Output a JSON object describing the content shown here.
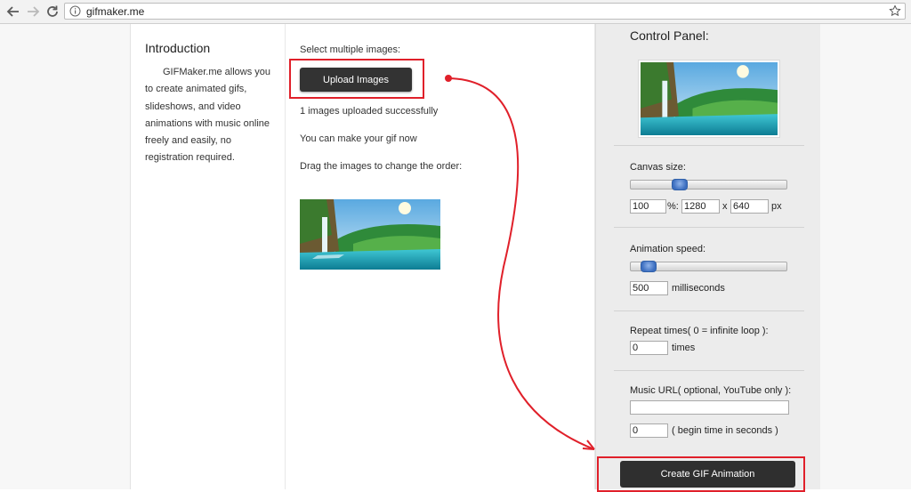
{
  "browser": {
    "url": "gifmaker.me",
    "icons": [
      "back-arrow-icon",
      "forward-arrow-icon",
      "reload-icon",
      "info-icon",
      "star-icon"
    ]
  },
  "intro": {
    "title": "Introduction",
    "text": "GIFMaker.me allows you to create animated gifs, slideshows, and video animations with music online freely and easily, no registration required."
  },
  "upload": {
    "prompt": "Select multiple images:",
    "button_label": "Upload Images",
    "status": "1 images uploaded successfully",
    "ready_text": "You can make your gif now",
    "drag_hint": "Drag the images to change the order:"
  },
  "control_panel": {
    "title": "Control Panel:",
    "canvas": {
      "label": "Canvas size:",
      "slider_fraction": 0.29,
      "percent": "100",
      "percent_unit": "%:",
      "width": "1280",
      "times_sep": "x",
      "height": "640",
      "px_unit": "px"
    },
    "speed": {
      "label": "Animation speed:",
      "slider_fraction": 0.07,
      "value": "500",
      "unit": "milliseconds"
    },
    "repeat": {
      "label": "Repeat times( 0 = infinite loop ):",
      "value": "0",
      "unit": "times"
    },
    "music": {
      "label": "Music URL( optional, YouTube only ):",
      "url_value": "",
      "begin_value": "0",
      "begin_unit": "( begin time in seconds )"
    },
    "create_button": "Create GIF Animation"
  },
  "colors": {
    "accent_annotation": "#e0202a",
    "button_dark": "#333333",
    "panel_bg": "#ececec"
  }
}
